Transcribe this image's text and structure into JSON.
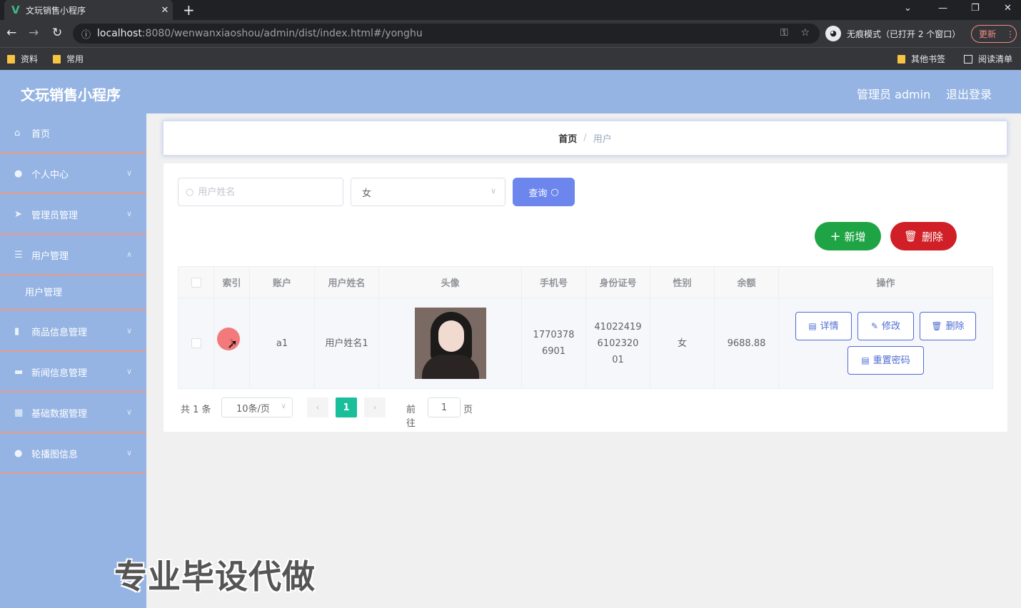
{
  "browser": {
    "tab_title": "文玩销售小程序",
    "tab_close": "✕",
    "new_tab": "+",
    "url_host": "localhost",
    "url_rest": ":8080/wenwanxiaoshou/admin/dist/index.html#/yonghu",
    "incognito_label": "无痕模式（已打开 2 个窗口）",
    "update_label": "更新",
    "bookmarks": [
      "资料",
      "常用"
    ],
    "other_bookmarks": "其他书签",
    "reading_list": "阅读清单"
  },
  "header": {
    "app_title": "文玩销售小程序",
    "user_label": "管理员 admin",
    "logout_label": "退出登录"
  },
  "sidebar": {
    "items": [
      {
        "label": "首页",
        "icon": "home-icon"
      },
      {
        "label": "个人中心",
        "icon": "user-icon"
      },
      {
        "label": "管理员管理",
        "icon": "send-icon"
      },
      {
        "label": "用户管理",
        "icon": "list-icon"
      },
      {
        "label": "用户管理",
        "icon": "",
        "sub": true
      },
      {
        "label": "商品信息管理",
        "icon": "bar-chart-icon"
      },
      {
        "label": "新闻信息管理",
        "icon": "monitor-icon"
      },
      {
        "label": "基础数据管理",
        "icon": "grid-icon"
      },
      {
        "label": "轮播图信息",
        "icon": "user-icon"
      }
    ]
  },
  "breadcrumb": {
    "home": "首页",
    "separator": "/",
    "current": "用户"
  },
  "search": {
    "name_placeholder": "用户姓名",
    "sex_value": "女",
    "query_label": "查询"
  },
  "actions": {
    "add_label": "新增",
    "delete_label": "删除"
  },
  "table": {
    "columns": [
      "索引",
      "账户",
      "用户姓名",
      "头像",
      "手机号",
      "身份证号",
      "性别",
      "余额",
      "操作"
    ],
    "rows": [
      {
        "index": "1",
        "account": "a1",
        "name": "用户姓名1",
        "phone": "17703786901",
        "id_card": "410224196102320 01",
        "sex": "女",
        "balance": "9688.88"
      }
    ],
    "op_buttons": {
      "detail": "详情",
      "edit": "修改",
      "delete": "删除",
      "reset": "重置密码"
    }
  },
  "pagination": {
    "total_text": "共 1 条",
    "page_size": "10条/页",
    "current_page": "1",
    "goto_label": "前往",
    "goto_value": "1",
    "page_label": "页"
  },
  "watermark": "专业毕设代做",
  "colors": {
    "header_bg": "#95b4e3",
    "query_btn": "#6c86ee",
    "add_btn": "#1fa445",
    "delete_btn": "#d01f26",
    "active_page": "#19be9b",
    "menu_divider": "#e89b86"
  }
}
